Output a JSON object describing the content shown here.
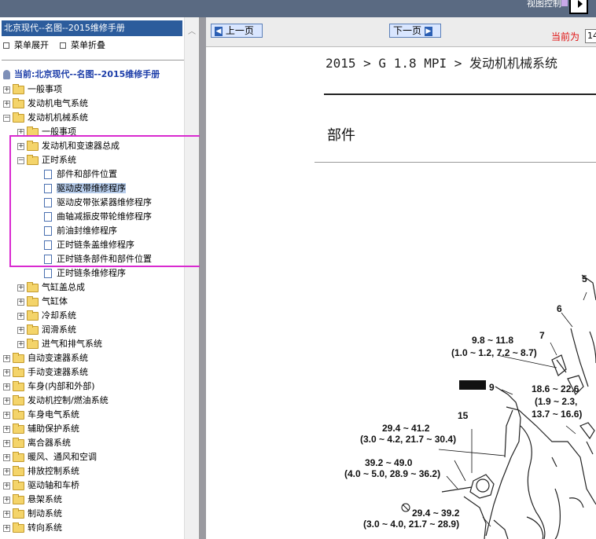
{
  "topbar": {
    "view_control": "视图控制"
  },
  "left": {
    "title": "北京现代--名图--2015维修手册",
    "expand_label": "菜单展开",
    "collapse_label": "菜单折叠",
    "current_label": "当前:北京现代--名图--2015维修手册",
    "tree": [
      {
        "label": "一般事项"
      },
      {
        "label": "发动机电气系统"
      },
      {
        "label": "发动机机械系统"
      },
      {
        "label": "一般事项"
      },
      {
        "label": "发动机和变速器总成"
      },
      {
        "label": "正时系统"
      },
      {
        "label": "部件和部件位置"
      },
      {
        "label": "驱动皮带维修程序"
      },
      {
        "label": "驱动皮带张紧器维修程序"
      },
      {
        "label": "曲轴减振皮带轮维修程序"
      },
      {
        "label": "前油封维修程序"
      },
      {
        "label": "正时链条盖维修程序"
      },
      {
        "label": "正时链条部件和部件位置"
      },
      {
        "label": "正时链条维修程序"
      },
      {
        "label": "气缸盖总成"
      },
      {
        "label": "气缸体"
      },
      {
        "label": "冷却系统"
      },
      {
        "label": "润滑系统"
      },
      {
        "label": "进气和排气系统"
      },
      {
        "label": "自动变速器系统"
      },
      {
        "label": "手动变速器系统"
      },
      {
        "label": "车身(内部和外部)"
      },
      {
        "label": "发动机控制/燃油系统"
      },
      {
        "label": "车身电气系统"
      },
      {
        "label": "辅助保护系统"
      },
      {
        "label": "离合器系统"
      },
      {
        "label": "暖风、通风和空调"
      },
      {
        "label": "排放控制系统"
      },
      {
        "label": "驱动轴和车桥"
      },
      {
        "label": "悬架系统"
      },
      {
        "label": "制动系统"
      },
      {
        "label": "转向系统"
      }
    ]
  },
  "right": {
    "prev_label": "上一页",
    "next_label": "下一页",
    "page_label": "当前为",
    "page_value": "14",
    "breadcrumb": "2015 > G 1.8 MPI > 发动机机械系统",
    "section_title": "部件",
    "diagram_labels": {
      "n5": "5",
      "n6": "6",
      "n7": "7",
      "n9": "9",
      "n15": "15",
      "t1a": "9.8 ~ 11.8",
      "t1b": "(1.0 ~ 1.2, 7.2 ~ 8.7)",
      "t2a": "18.6 ~ 22.6",
      "t2b": "(1.9 ~ 2.3,",
      "t2c": "13.7 ~ 16.6)",
      "t3a": "29.4 ~ 41.2",
      "t3b": "(3.0 ~ 4.2, 21.7 ~ 30.4)",
      "t4a": "39.2 ~ 49.0",
      "t4b": "(4.0 ~ 5.0, 28.9 ~ 36.2)",
      "t5a": "29.4 ~ 39.2",
      "t5b": "(3.0 ~ 4.0, 21.7 ~ 28.9)"
    }
  }
}
